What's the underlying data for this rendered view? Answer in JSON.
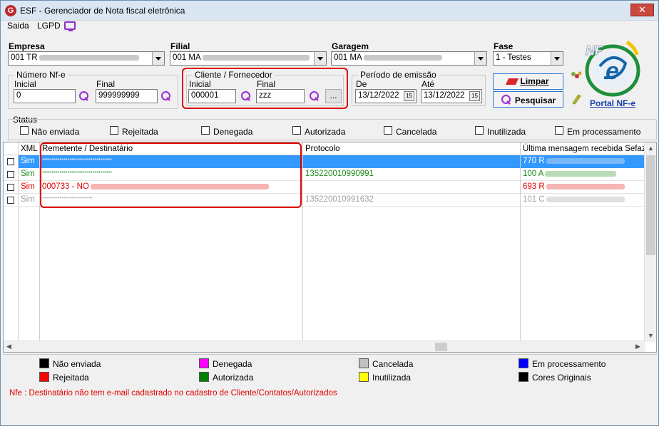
{
  "window": {
    "title": "ESF - Gerenciador de Nota fiscal eletrônica",
    "app_icon": "G",
    "close_glyph": "✕"
  },
  "menu": [
    {
      "label": "Saida"
    },
    {
      "label": "LGPD"
    }
  ],
  "filters": {
    "empresa": {
      "label": "Empresa",
      "value": "001 TR"
    },
    "filial": {
      "label": "Filial",
      "value": "001 MA"
    },
    "garagem": {
      "label": "Garagem",
      "value": "001 MA"
    },
    "fase": {
      "label": "Fase",
      "value": "1 - Testes"
    },
    "numero_nfe": {
      "label": "Número Nf-e",
      "inicial_label": "Inicial",
      "inicial_value": "0",
      "final_label": "Final",
      "final_value": "999999999"
    },
    "cliente": {
      "label": "Cliente / Fornecedor",
      "inicial_label": "Inicial",
      "inicial_value": "000001",
      "final_label": "Final",
      "final_value": "zzz",
      "more_button": "..."
    },
    "periodo": {
      "label": "Período de emissão",
      "de_label": "De",
      "de_value": "13/12/2022",
      "ate_label": "Até",
      "ate_value": "13/12/2022",
      "cal_glyph": "15"
    }
  },
  "buttons": {
    "limpar": "Limpar",
    "pesquisar": "Pesquisar",
    "portal": "Portal NF-e"
  },
  "status": {
    "label": "Status",
    "options": [
      "Não enviada",
      "Rejeitada",
      "Denegada",
      "Autorizada",
      "Cancelada",
      "Inutilizada",
      "Em processamento"
    ]
  },
  "grid": {
    "columns": [
      "XML",
      "Remetente / Destinatário",
      "Protocolo",
      "Última mensagem recebida Sefaz"
    ],
    "rows": [
      {
        "xml": "Sim",
        "remetente": "************************************",
        "protocolo": "",
        "mensagem": "770 R",
        "color": "#ffffff",
        "selected": true
      },
      {
        "xml": "Sim",
        "remetente": "************************************",
        "protocolo": "135220010990991",
        "mensagem": "100 A",
        "color": "#1a8a1a",
        "selected": false
      },
      {
        "xml": "Sim",
        "remetente": "000733 - NO",
        "protocolo": "",
        "mensagem": "693 R",
        "color": "#e00000",
        "selected": false
      },
      {
        "xml": "Sim",
        "remetente": "**************************",
        "protocolo": "135220010991632",
        "mensagem": "101 C",
        "color": "#a0a0a0",
        "selected": false
      }
    ]
  },
  "legend": [
    {
      "label": "Não enviada",
      "color": "#000000"
    },
    {
      "label": "Rejeitada",
      "color": "#ff0000"
    },
    {
      "label": "Denegada",
      "color": "#ff00ff"
    },
    {
      "label": "Autorizada",
      "color": "#008000"
    },
    {
      "label": "Cancelada",
      "color": "#c0c0c0"
    },
    {
      "label": "Inutilizada",
      "color": "#ffff00"
    },
    {
      "label": "Em processamento",
      "color": "#0000ff"
    },
    {
      "label": "Cores Originais",
      "color": "#000000"
    }
  ],
  "footer": {
    "text": "Nfe    : Destinatário não tem e-mail cadastrado no cadastro de Cliente/Contatos/Autorizados"
  }
}
